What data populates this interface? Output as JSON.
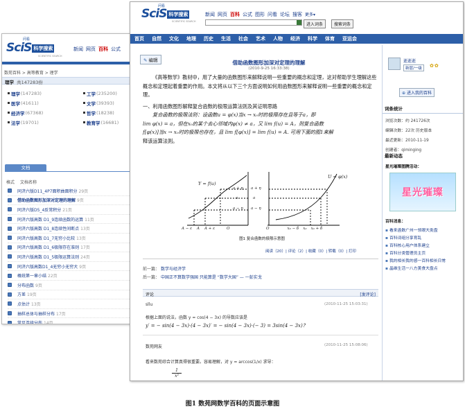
{
  "back": {
    "logo": {
      "tiny": "问看",
      "scis": "SciS",
      "cn": "科学搜索",
      "sub": "SCIENTIFIC SEARCH"
    },
    "nav": [
      "新闻",
      "网页",
      "百科",
      "公式"
    ],
    "nav_active": 2,
    "breadcrumb": "数苑百科 > 高等教育 > 理学",
    "subject_title": "理学",
    "subject_count": "共147283份",
    "subjects_left": [
      {
        "name": "理学",
        "count": "(147283)"
      },
      {
        "name": "医学",
        "count": "(41611)"
      },
      {
        "name": "经济学",
        "count": "(67368)"
      },
      {
        "name": "法学",
        "count": "(19701)"
      }
    ],
    "subjects_right": [
      {
        "name": "工学",
        "count": "(235200)"
      },
      {
        "name": "文学",
        "count": "(39393)"
      },
      {
        "name": "哲学",
        "count": "(18238)"
      },
      {
        "name": "教育学",
        "count": "(16681)"
      }
    ],
    "docs_tab": "文档",
    "col_format": "格式",
    "col_name": "文档名称",
    "docs": [
      {
        "title": "同济六版D11_4P7面积曲面积分",
        "pages": "29页"
      },
      {
        "title": "借助函数图形加深对定理的理解",
        "pages": "9页"
      },
      {
        "title": "同济六版D5_4反常积分",
        "pages": "21页"
      },
      {
        "title": "同济六版高数 D1_9连续函数的运算",
        "pages": "11页"
      },
      {
        "title": "同济六版高数 D1_8连续性间断点",
        "pages": "13页"
      },
      {
        "title": "同济六版高数 D1_7无穷小比较",
        "pages": "13页"
      },
      {
        "title": "同济六版高数 D1_6极限存在准则",
        "pages": "17页"
      },
      {
        "title": "同济六版高数 D1_5极限运算法则",
        "pages": "24页"
      },
      {
        "title": "同济六版高数D1_4无穷小无穷大",
        "pages": "9页"
      },
      {
        "title": "概统第一章小结",
        "pages": "22页"
      },
      {
        "title": "分布函数",
        "pages": "9页"
      },
      {
        "title": "方差",
        "pages": "19页"
      },
      {
        "title": "点估计",
        "pages": "13页"
      },
      {
        "title": "抽样总体与抽样分布",
        "pages": "17页"
      },
      {
        "title": "常见连续分布",
        "pages": "14页"
      },
      {
        "title": "专升本计算机数学试卷",
        "pages": "8页"
      }
    ]
  },
  "front": {
    "logo": {
      "tiny": "问看",
      "scis": "SciS",
      "cn": "科学搜索",
      "sub": "SCIENTIFIC SEARCH"
    },
    "nav": [
      "新闻",
      "网页",
      "百科",
      "公式",
      "图形",
      "问看",
      "论坛",
      "搜客"
    ],
    "nav_more": "更多▾",
    "nav_active": 2,
    "btn_enter": "进入词条",
    "btn_search": "搜索词条",
    "categories": [
      "首页",
      "自然",
      "文化",
      "地理",
      "历史",
      "生活",
      "社会",
      "艺术",
      "人物",
      "经济",
      "科学",
      "体育",
      "亚运会"
    ],
    "edit_btn": "编辑",
    "title": "借助函数图形加深对定理的理解",
    "date": "(2010-9-25 16:33:38)",
    "para1": "《高等数学》教材中，用了大量的函数图形来解释说明一些重要的概念和定理，这对帮助学生理解这些概念和定理起着重要的作用。本文将从以下三个方面说明如何用函数图形来解释说明一些重要的概念和定理。",
    "section1": "一、利用函数图形解释复合函数的极限运算法则及其证明思路",
    "para2a": "复合函数的极限法则：设函数u = φ(x)当x → x₀时的极限存在且等于a，即",
    "para2b": "lim φ(x) = a，但在x₀的某个去心邻域内φ(x) ≠ a，又 lim f(u) = A，则复合函数",
    "para2c": "f[φ(x)]当x → x₀时的极限也存在，且 lim f[φ(x)] = lim f(u) = A. 可用下面的图1来解",
    "para2d": "释该运算法则。",
    "figure": {
      "left_label": "Y = f(u)",
      "right_label": "U = φ(x)",
      "lt_labels": [
        "a + η",
        "a",
        "a − η"
      ],
      "rt_labels": [
        "a + η",
        "a",
        "a − η"
      ],
      "lx_labels": [
        "A − ε",
        "A",
        "A + ε",
        "O"
      ],
      "rx_labels": [
        "O",
        "x₀ − δ",
        "x₀",
        "x₀ + δ"
      ],
      "caption": "图1 复合函数的极限示意图"
    },
    "stats": "阅读（20）| 评论（2）| 收藏（0）| 转载（0）| 打印",
    "prev_label": "前一篇：",
    "prev_link": "数学与经济学",
    "next_label": "后一篇：",
    "next_link": "中国正不算数学强国 只能算是 “数学大国” — 一彭实戈",
    "comments_label": "评论",
    "post_comment": "[发评论]",
    "comment1": {
      "user": "sllu",
      "time": "(2010-11-25 15:03:31)",
      "text": "根据上面的说法，函数 y = cos(4 − 3x) 的导数应该是",
      "formula": "y′ = − sin(4 − 3x)·(4 − 3x)′ = − sin(4 − 3x)·(− 3) = 3sin(4 − 3x)？"
    },
    "comment2": {
      "user": "数苑网友",
      "time": "(2010-11-25 15:08:06)",
      "text": "看来数苑综合计算真得很重要。容易理解，对 y = arccos(1/x) 求导："
    },
    "comment2_frac": {
      "num": "1",
      "den": "x²"
    },
    "sidebar": {
      "user": "逝逝逝",
      "user_link": "新层/一级",
      "enter_btn": "进入我的百科",
      "stats_title": "词条统计",
      "stats": [
        "浏览次数：约 241726次",
        "编辑次数：22次 历史版本",
        "最近更新：2010-11-19",
        "创建者：qiminging"
      ],
      "news_title": "最新动态",
      "promo_title": "星光璀璨图腾活动：",
      "promo_text": "星光璀璨",
      "wiki_title": "百科消息：",
      "wiki_items": [
        "看来函数广州一领眼大类盘",
        "百科词组分享育乱",
        "百科核心用户体系建立",
        "百科分类管理员主页",
        "我的相长我的感一百科相长日常",
        "晶维生活一八方美食大盘点"
      ]
    }
  },
  "caption": "图1   数苑网数学百科的页面示意图"
}
